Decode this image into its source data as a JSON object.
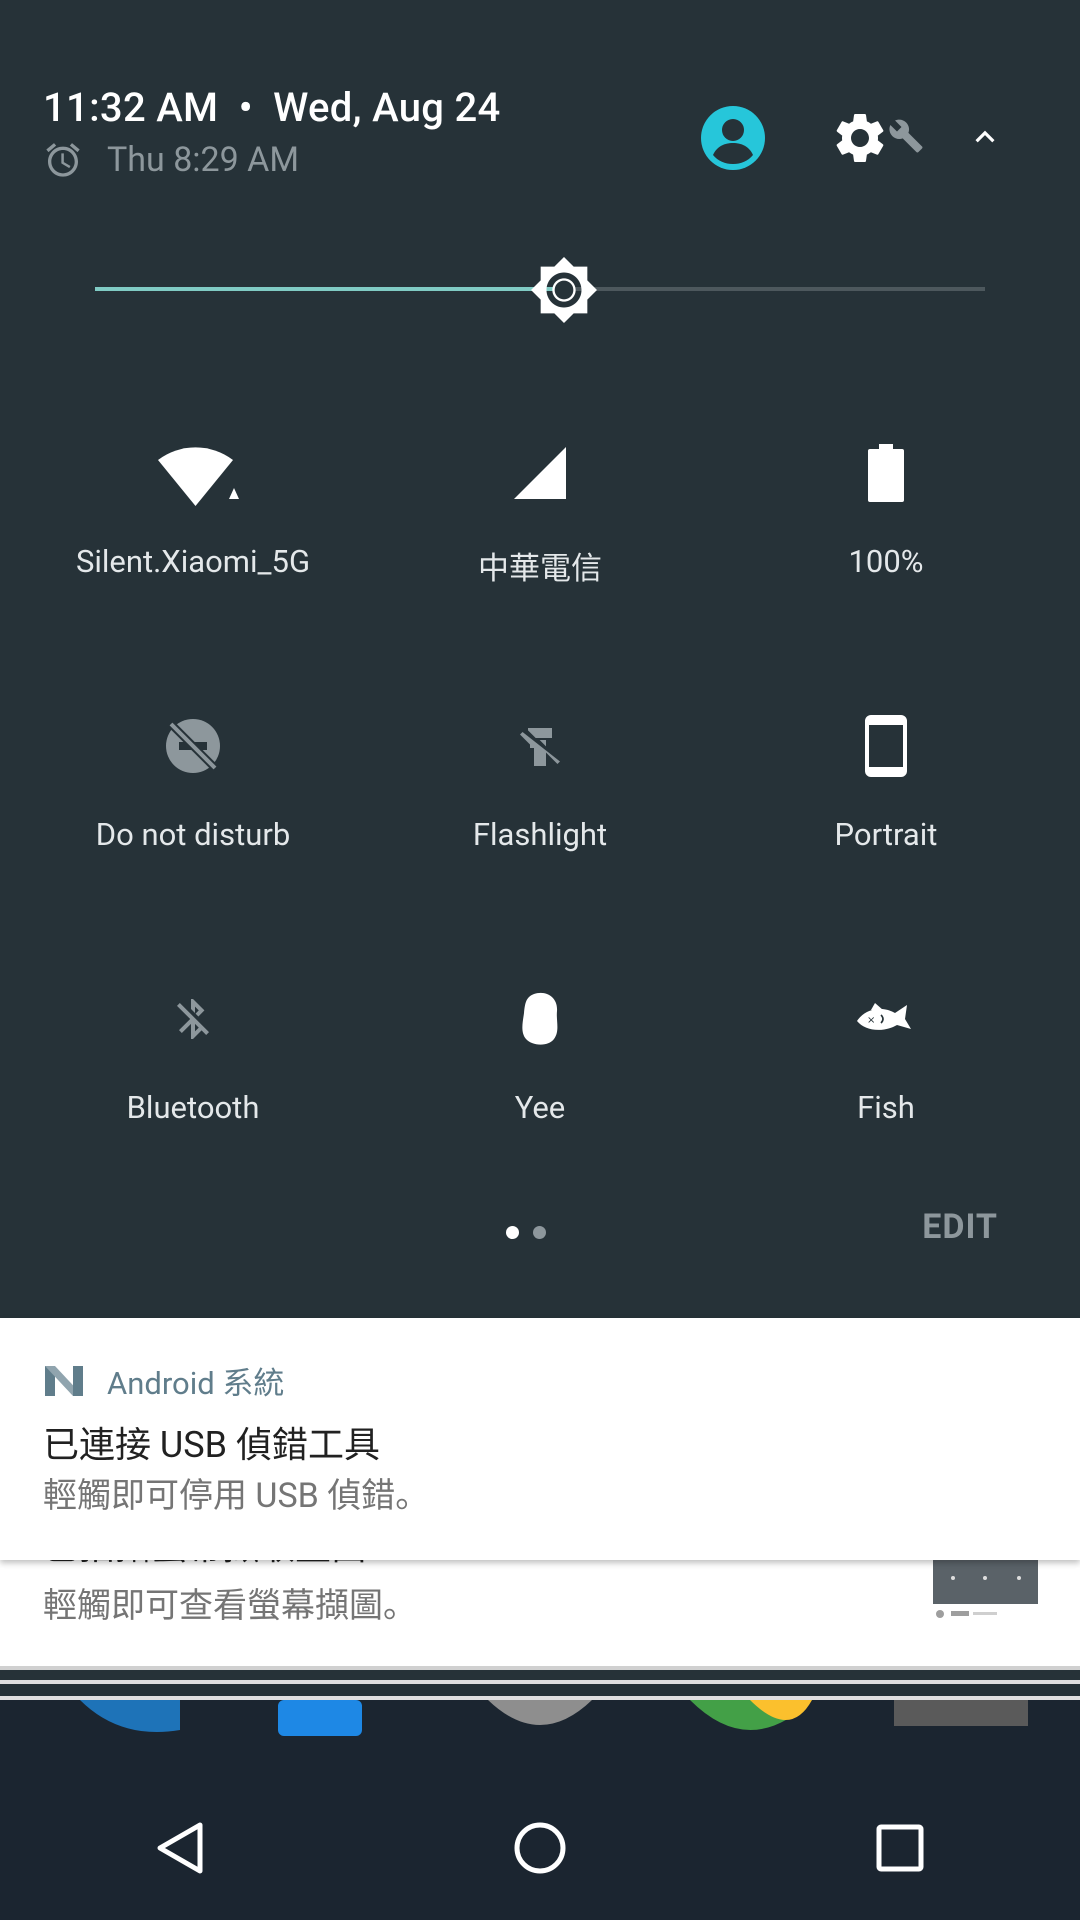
{
  "status": {
    "time": "11:32 AM",
    "separator": "•",
    "date": "Wed, Aug 24",
    "alarm": "Thu 8:29 AM"
  },
  "brightness": {
    "level_fraction": 0.527
  },
  "tiles": [
    {
      "label": "Silent.Xiaomi_5G",
      "icon": "wifi-icon",
      "active": true
    },
    {
      "label": "中華電信",
      "icon": "cell-signal-icon",
      "active": true
    },
    {
      "label": "100%",
      "icon": "battery-icon",
      "active": true
    },
    {
      "label": "Do not disturb",
      "icon": "do-not-disturb-icon",
      "active": false
    },
    {
      "label": "Flashlight",
      "icon": "flashlight-off-icon",
      "active": false
    },
    {
      "label": "Portrait",
      "icon": "portrait-icon",
      "active": true
    },
    {
      "label": "Bluetooth",
      "icon": "bluetooth-off-icon",
      "active": false
    },
    {
      "label": "Yee",
      "icon": "yee-icon",
      "active": true
    },
    {
      "label": "Fish",
      "icon": "fish-icon",
      "active": true
    }
  ],
  "pager": {
    "current_page": 1,
    "total_pages": 2
  },
  "edit_label": "EDIT",
  "notifications": [
    {
      "app": "Android 系統",
      "title": "已連接 USB 偵錯工具",
      "text": "輕觸即可停用 USB 偵錯。"
    },
    {
      "title": "已拍攝螢幕擷取畫面",
      "text": "輕觸即可查看螢幕擷圖。"
    }
  ],
  "colors": {
    "shade_bg": "#263238",
    "accent": "#80cbc4",
    "avatar": "#26c6da",
    "dim": "#8d979c"
  }
}
